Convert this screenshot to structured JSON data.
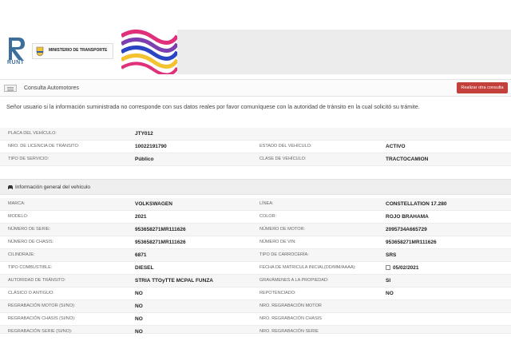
{
  "brand": {
    "runt": "RUNT",
    "ministry": "MINISTERIO DE TRANSPORTE"
  },
  "header": {
    "breadcrumb": "Consulta Automotores",
    "new_query_button": "Realizar otra consulta"
  },
  "notice": "Señor usuario si la información suministrada no corresponde con sus datos reales por favor comuníquese con la autoridad de tránsito en la cual solicitó su trámite.",
  "summary": {
    "rows": [
      {
        "l1": "PLACA DEL VEHÍCULO:",
        "v1": "JTY012",
        "l2": "",
        "v2": ""
      },
      {
        "l1": "NRO. DE LICENCIA DE TRÁNSITO:",
        "v1": "10022191790",
        "l2": "ESTADO DEL VEHÍCULO:",
        "v2": "ACTIVO"
      },
      {
        "l1": "TIPO DE SERVICIO:",
        "v1": "Público",
        "l2": "CLASE DE VEHÍCULO:",
        "v2": "TRACTOCAMION"
      }
    ]
  },
  "general": {
    "title": "Información general del vehículo",
    "rows": [
      {
        "l1": "MARCA:",
        "v1": "VOLKSWAGEN",
        "l2": "LÍNEA:",
        "v2": "CONSTELLATION 17.280"
      },
      {
        "l1": "MODELO:",
        "v1": "2021",
        "l2": "COLOR:",
        "v2": "ROJO BRAHAMA"
      },
      {
        "l1": "NÚMERO DE SERIE:",
        "v1": "953658271MR111626",
        "l2": "NÚMERO DE MOTOR:",
        "v2": "2095734A665729"
      },
      {
        "l1": "NÚMERO DE CHASIS:",
        "v1": "953658271MR111626",
        "l2": "NÚMERO DE VIN:",
        "v2": "953658271MR111626"
      },
      {
        "l1": "CILINDRAJE:",
        "v1": "6871",
        "l2": "TIPO DE CARROCERÍA:",
        "v2": "SRS"
      },
      {
        "l1": "TIPO COMBUSTIBLE:",
        "v1": "DIESEL",
        "l2": "FECHA DE MATRICULA INICIAL(DD/MM/AAAA):",
        "v2": "05/02/2021"
      },
      {
        "l1": "AUTORIDAD DE TRÁNSITO:",
        "v1": "STRIA TTOyTTE MCPAL FUNZA",
        "l2": "GRAVÁMENES A LA PROPIEDAD:",
        "v2": "SI"
      },
      {
        "l1": "CLÁSICO O ANTIGUO:",
        "v1": "NO",
        "l2": "REPOTENCIADO:",
        "v2": "NO"
      },
      {
        "l1": "REGRABACIÓN MOTOR (SI/NO):",
        "v1": "NO",
        "l2": "NRO. REGRABACIÓN MOTOR",
        "v2": ""
      },
      {
        "l1": "REGRABACIÓN CHASIS (SI/NO):",
        "v1": "NO",
        "l2": "NRO. REGRABACIÓN CHASIS",
        "v2": ""
      },
      {
        "l1": "REGRABACIÓN SERIE (SI/NO):",
        "v1": "NO",
        "l2": "NRO. REGRABACIÓN SERIE",
        "v2": ""
      }
    ]
  },
  "colors": {
    "accent": "#c4403b",
    "section_bg": "#efefef"
  }
}
